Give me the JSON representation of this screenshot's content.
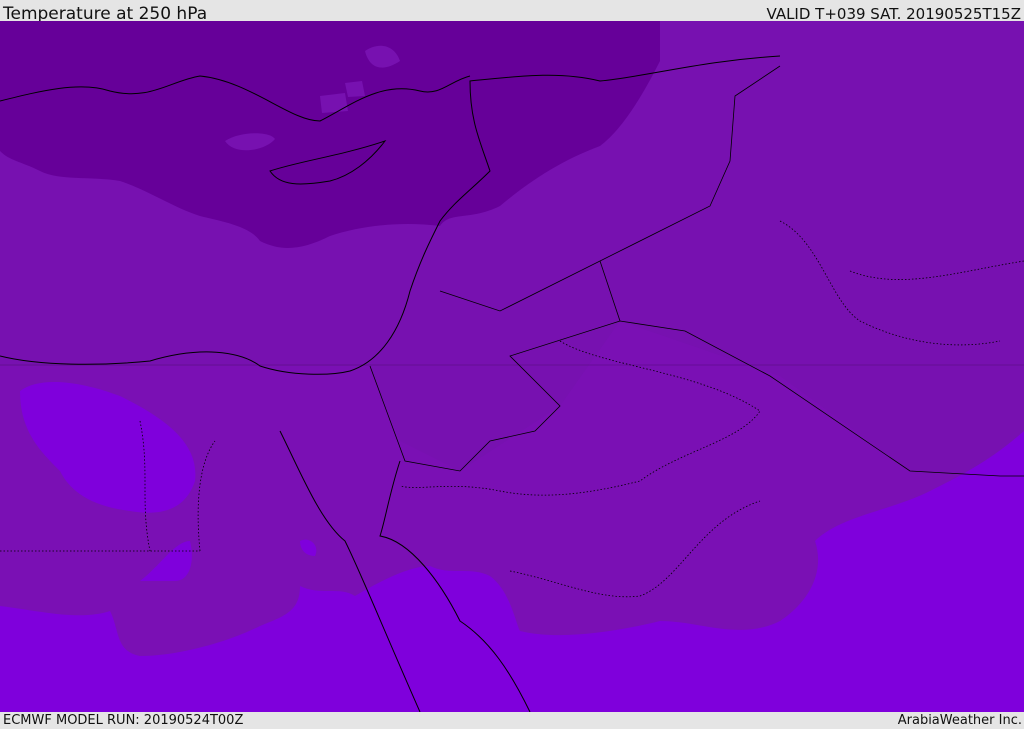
{
  "header": {
    "title": "Temperature at 250 hPa",
    "valid": "VALID T+039 SAT. 20190525T15Z"
  },
  "footer": {
    "model_run": "ECMWF MODEL RUN: 20190524T00Z",
    "credit": "ArabiaWeather Inc."
  },
  "colors": {
    "coldest": "#660099",
    "cold": "#7711b0",
    "mid": "#7a10b4",
    "warm": "#7f00dc",
    "border": "#000000"
  }
}
